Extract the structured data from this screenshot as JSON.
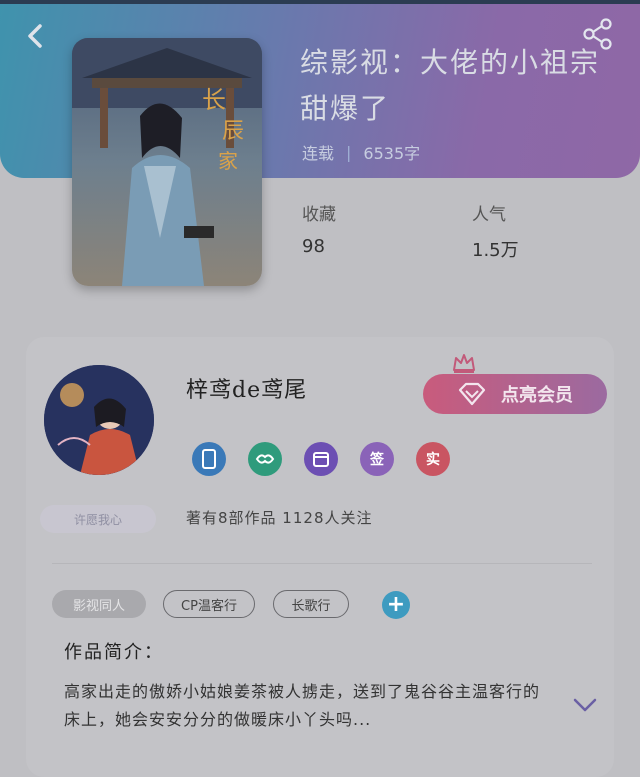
{
  "book": {
    "title": "综影视：大佬的小祖宗甜爆了",
    "status": "连载",
    "separator": "|",
    "word_count": "6535字",
    "stats": [
      {
        "label": "收藏",
        "value": "98"
      },
      {
        "label": "人气",
        "value": "1.5万"
      }
    ]
  },
  "author": {
    "name": "梓鸢de鸢尾",
    "vip_button": "点亮会员",
    "tag_left": "许愿我心",
    "follow_text": "著有8部作品 1128人关注",
    "badges": [
      {
        "icon": "phone-icon",
        "color": "#3a79b8"
      },
      {
        "icon": "handshake-icon",
        "color": "#2f9b7c"
      },
      {
        "icon": "calendar-icon",
        "color": "#6c4fb3"
      },
      {
        "text": "签",
        "color": "#8a63b8"
      },
      {
        "text": "实",
        "color": "#c95562"
      }
    ]
  },
  "tags": [
    "影视同人",
    "CP温客行",
    "长歌行"
  ],
  "intro": {
    "label": "作品简介：",
    "text": "高家出走的傲娇小姑娘姜茶被人掳走，送到了鬼谷谷主温客行的床上，她会安安分分的做暖床小丫头吗..."
  },
  "colors": {
    "header_start": "#3f93ad",
    "header_end": "#8f68a6",
    "vip_start": "#c95b7c",
    "vip_end": "#9b6aa0",
    "add_button": "#3e9bc0"
  }
}
